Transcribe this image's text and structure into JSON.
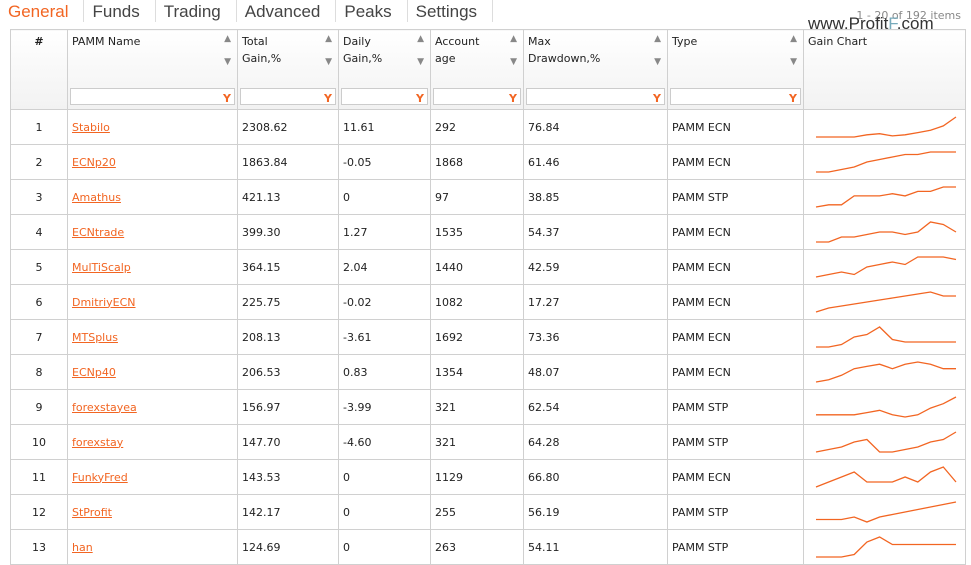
{
  "tabs": [
    "General",
    "Funds",
    "Trading",
    "Advanced",
    "Peaks",
    "Settings"
  ],
  "pager": "1 - 20 of 192 items",
  "watermark": "www.ProfitF.com",
  "columns": [
    "#",
    "PAMM Name",
    "Total Gain,%",
    "Daily Gain,%",
    "Account age",
    "Max Drawdown,%",
    "Type",
    "Gain Chart"
  ],
  "accent": "#f26522",
  "rows": [
    {
      "n": "1",
      "name": "Stabilo",
      "total": "2308.62",
      "daily": "11.61",
      "age": "292",
      "dd": "76.84",
      "type": "PAMM ECN",
      "spark": [
        0,
        0,
        0,
        0,
        1,
        1.5,
        0.5,
        1,
        2,
        3,
        5,
        9
      ]
    },
    {
      "n": "2",
      "name": "ECNp20",
      "total": "1863.84",
      "daily": "-0.05",
      "age": "1868",
      "dd": "61.46",
      "type": "PAMM ECN",
      "spark": [
        0,
        0,
        1,
        2,
        4,
        5,
        6,
        7,
        7,
        8,
        8,
        8
      ]
    },
    {
      "n": "3",
      "name": "Amathus",
      "total": "421.13",
      "daily": "0",
      "age": "97",
      "dd": "38.85",
      "type": "PAMM STP",
      "spark": [
        0,
        1,
        1,
        5,
        5,
        5,
        6,
        5,
        7,
        7,
        9,
        9
      ]
    },
    {
      "n": "4",
      "name": "ECNtrade",
      "total": "399.30",
      "daily": "1.27",
      "age": "1535",
      "dd": "54.37",
      "type": "PAMM ECN",
      "spark": [
        0,
        0,
        2,
        2,
        3,
        4,
        4,
        3,
        4,
        8,
        7,
        4
      ]
    },
    {
      "n": "5",
      "name": "MulTiScalp",
      "total": "364.15",
      "daily": "2.04",
      "age": "1440",
      "dd": "42.59",
      "type": "PAMM ECN",
      "spark": [
        0,
        1,
        2,
        1,
        4,
        5,
        6,
        5,
        8,
        8,
        8,
        7
      ]
    },
    {
      "n": "6",
      "name": "DmitriyECN",
      "total": "225.75",
      "daily": "-0.02",
      "age": "1082",
      "dd": "17.27",
      "type": "PAMM ECN",
      "spark": [
        0,
        2,
        3,
        4,
        5,
        6,
        7,
        8,
        9,
        10,
        8,
        8
      ]
    },
    {
      "n": "7",
      "name": "MTSplus",
      "total": "208.13",
      "daily": "-3.61",
      "age": "1692",
      "dd": "73.36",
      "type": "PAMM ECN",
      "spark": [
        0,
        0,
        1,
        4,
        5,
        8,
        3,
        2,
        2,
        2,
        2,
        2
      ]
    },
    {
      "n": "8",
      "name": "ECNp40",
      "total": "206.53",
      "daily": "0.83",
      "age": "1354",
      "dd": "48.07",
      "type": "PAMM ECN",
      "spark": [
        0,
        1,
        3,
        6,
        7,
        8,
        6,
        8,
        9,
        8,
        6,
        6
      ]
    },
    {
      "n": "9",
      "name": "forexstayea",
      "total": "156.97",
      "daily": "-3.99",
      "age": "321",
      "dd": "62.54",
      "type": "PAMM STP",
      "spark": [
        0,
        0,
        0,
        0,
        1,
        2,
        0,
        -1,
        0,
        3,
        5,
        8
      ]
    },
    {
      "n": "10",
      "name": "forexstay",
      "total": "147.70",
      "daily": "-4.60",
      "age": "321",
      "dd": "64.28",
      "type": "PAMM STP",
      "spark": [
        0,
        1,
        2,
        4,
        5,
        0,
        0,
        1,
        2,
        4,
        5,
        8
      ]
    },
    {
      "n": "11",
      "name": "FunkyFred",
      "total": "143.53",
      "daily": "0",
      "age": "1129",
      "dd": "66.80",
      "type": "PAMM ECN",
      "spark": [
        0,
        1,
        2,
        3,
        1,
        1,
        1,
        2,
        1,
        3,
        4,
        1
      ]
    },
    {
      "n": "12",
      "name": "StProfit",
      "total": "142.17",
      "daily": "0",
      "age": "255",
      "dd": "56.19",
      "type": "PAMM STP",
      "spark": [
        0,
        0,
        0,
        1,
        -1,
        1,
        2,
        3,
        4,
        5,
        6,
        7
      ]
    },
    {
      "n": "13",
      "name": "han",
      "total": "124.69",
      "daily": "0",
      "age": "263",
      "dd": "54.11",
      "type": "PAMM STP",
      "spark": [
        0,
        0,
        0,
        1,
        6,
        8,
        5,
        5,
        5,
        5,
        5,
        5
      ]
    }
  ]
}
